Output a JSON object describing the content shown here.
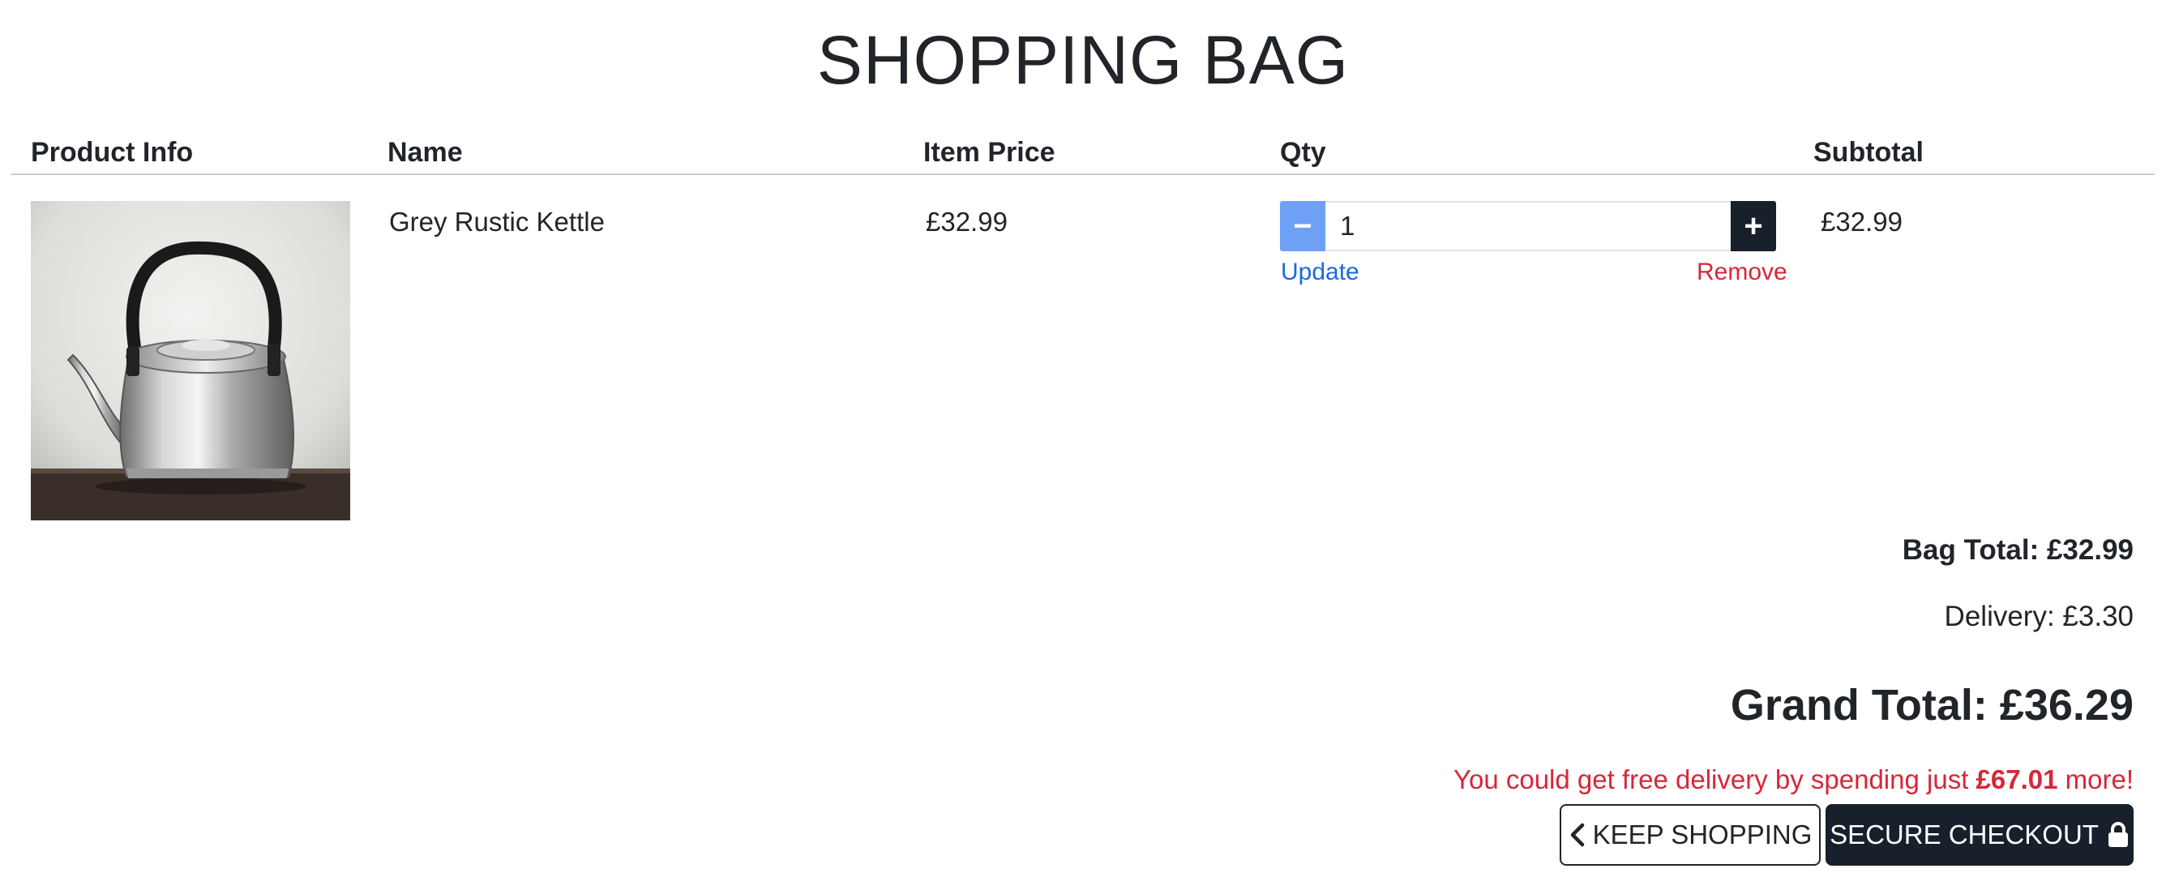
{
  "page": {
    "title": "SHOPPING BAG"
  },
  "table": {
    "headers": {
      "product_info": "Product Info",
      "name": "Name",
      "item_price": "Item Price",
      "qty": "Qty",
      "subtotal": "Subtotal"
    },
    "rows": [
      {
        "image": "grey-rustic-kettle-photo",
        "name": "Grey Rustic Kettle",
        "item_price": "£32.99",
        "qty": "1",
        "subtotal": "£32.99",
        "update_label": "Update",
        "remove_label": "Remove",
        "decrement_symbol": "−",
        "increment_symbol": "+"
      }
    ]
  },
  "summary": {
    "bag_total": "Bag Total: £32.99",
    "delivery": "Delivery: £3.30",
    "grand_total": "Grand Total: £36.29",
    "free_delivery_prefix": "You could get free delivery by spending just ",
    "free_delivery_amount": "£67.01",
    "free_delivery_suffix": " more!"
  },
  "actions": {
    "keep_shopping_label": "KEEP SHOPPING",
    "keep_shopping_icon": "chevron-left-icon",
    "secure_checkout_label": "SECURE CHECKOUT",
    "secure_checkout_icon": "lock-icon"
  },
  "colors": {
    "minus_button": "#6ea1f6",
    "dark": "#17202b",
    "link_blue": "#1a6ae0",
    "alert_red": "#d72638"
  }
}
